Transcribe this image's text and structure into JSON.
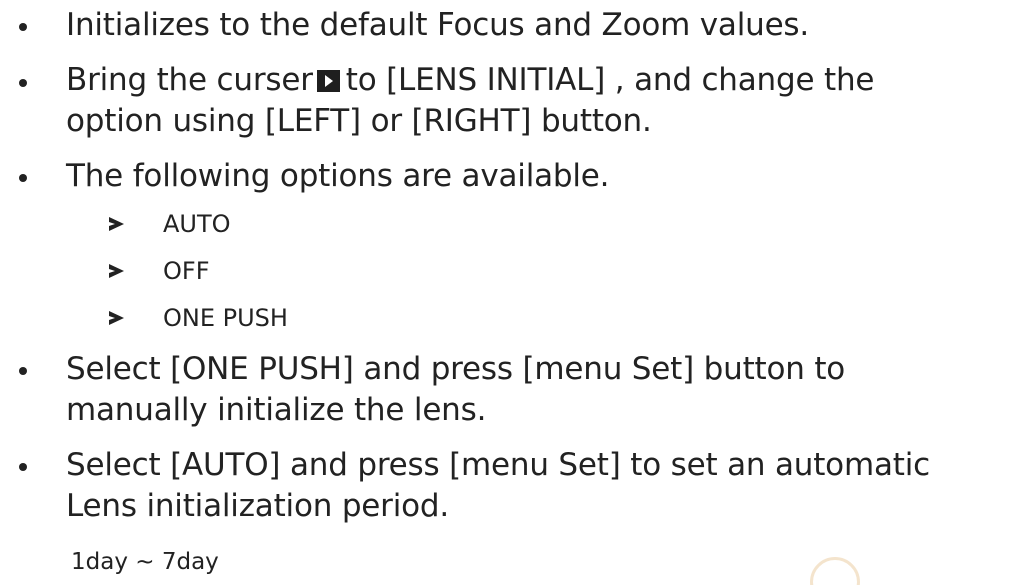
{
  "bullets": [
    {
      "lines": [
        "Initializes to the default Focus and Zoom values."
      ]
    },
    {
      "line1_before": "Bring the curser",
      "line1_after": "to [LENS INITIAL] , and change the",
      "line2": "option using [LEFT] or [RIGHT] button."
    },
    {
      "lines": [
        "The following options are available."
      ]
    },
    {
      "lines": [
        "Select [ONE PUSH] and press [menu Set] button to",
        "manually initialize the lens."
      ]
    },
    {
      "lines": [
        "Select [AUTO] and press [menu Set] to set an automatic",
        "Lens initialization period."
      ]
    }
  ],
  "options": [
    "AUTO",
    "OFF",
    "ONE PUSH"
  ],
  "range": "1day ~ 7day",
  "icons": {
    "bullet": "bullet-dot-icon",
    "cursor": "cursor-play-icon",
    "sub_bullet": "arrow-bullet-icon"
  },
  "colors": {
    "text": "#222222",
    "background": "#ffffff"
  }
}
